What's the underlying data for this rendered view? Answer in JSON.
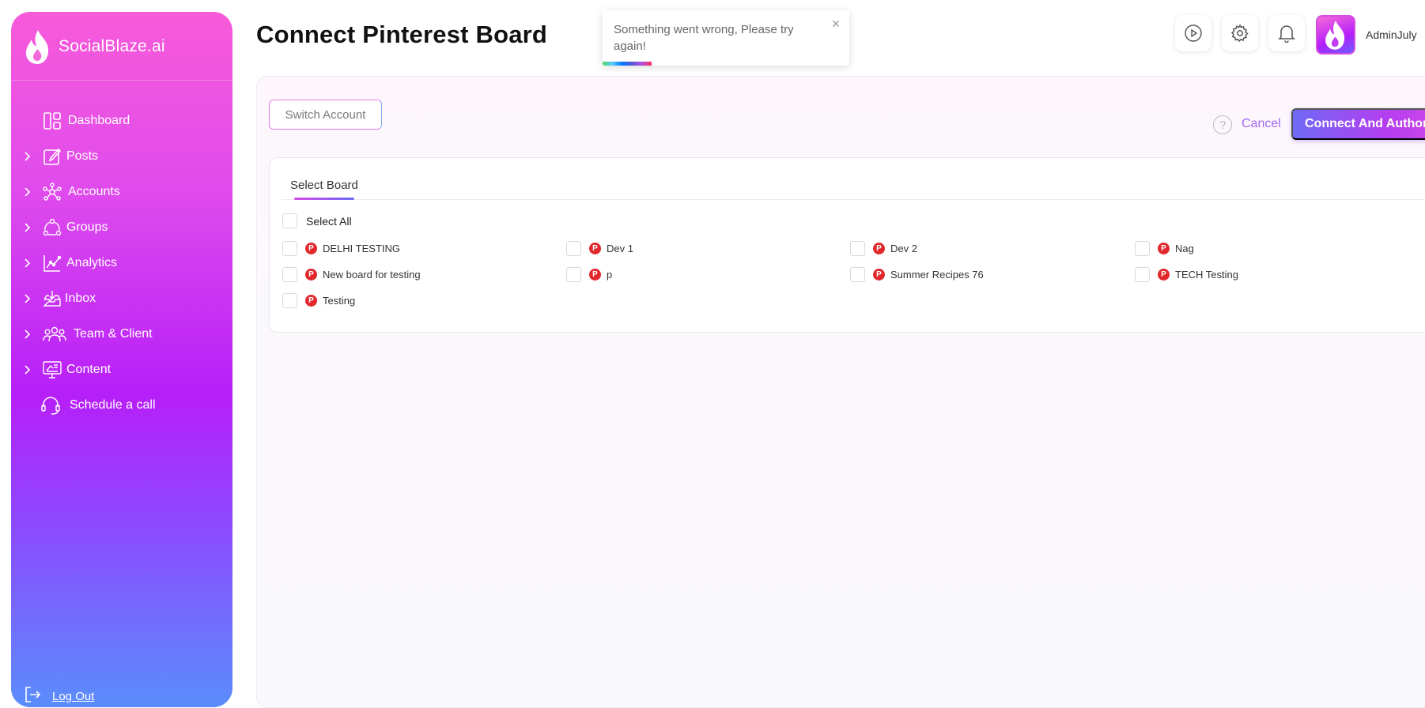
{
  "brand": {
    "name": "SocialBlaze.ai"
  },
  "sidebar": {
    "items": [
      {
        "label": "Dashboard",
        "icon": "dashboard-icon",
        "expandable": false
      },
      {
        "label": "Posts",
        "icon": "edit-icon",
        "expandable": true
      },
      {
        "label": "Accounts",
        "icon": "network-icon",
        "expandable": true
      },
      {
        "label": "Groups",
        "icon": "groups-icon",
        "expandable": true
      },
      {
        "label": "Analytics",
        "icon": "analytics-icon",
        "expandable": true
      },
      {
        "label": "Inbox",
        "icon": "inbox-icon",
        "expandable": true
      },
      {
        "label": "Team & Client",
        "icon": "team-icon",
        "expandable": true
      },
      {
        "label": "Content",
        "icon": "content-icon",
        "expandable": true
      },
      {
        "label": "Schedule a call",
        "icon": "headset-icon",
        "expandable": false
      }
    ],
    "logout": "Log Out"
  },
  "header": {
    "title": "Connect Pinterest Board",
    "user_name": "AdminJuly"
  },
  "toast": {
    "message": "Something went wrong, Please try again!",
    "close": "×"
  },
  "actions": {
    "switch_account": "Switch Account",
    "help": "?",
    "cancel": "Cancel",
    "connect": "Connect And Authorize"
  },
  "boards": {
    "tab": "Select Board",
    "select_all": "Select All",
    "items": [
      "DELHI TESTING",
      "Dev 1",
      "Dev 2",
      "Nag",
      "New board for testing",
      "p",
      "Summer Recipes 76",
      "TECH Testing",
      "Testing"
    ],
    "pin_glyph": "P"
  },
  "colors": {
    "accent": "#b43ef0",
    "pinterest": "#e0282d",
    "sidebar_top": "#f75ad9",
    "sidebar_bottom": "#5a8dfc"
  }
}
